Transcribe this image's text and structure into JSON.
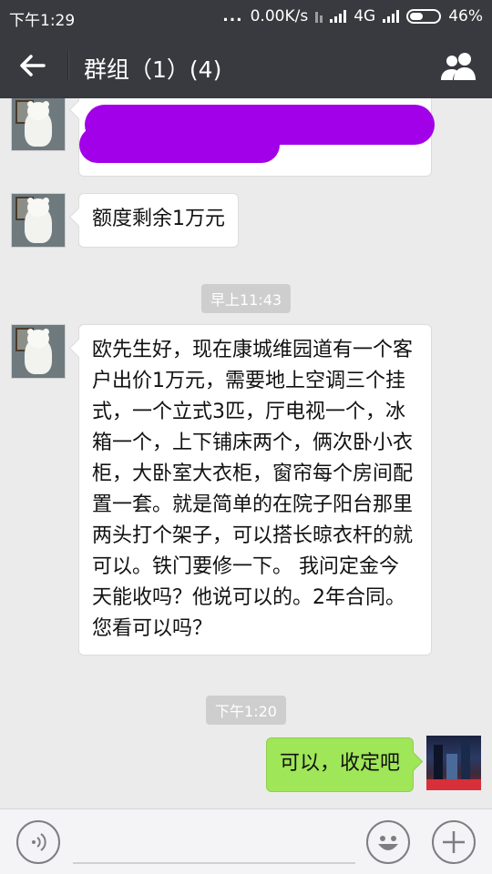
{
  "status_bar": {
    "time": "下午1:29",
    "dots": "...",
    "network_speed": "0.00K/s",
    "network_type": "4G",
    "battery": "46%"
  },
  "header": {
    "title": "群组（1）(4)"
  },
  "messages": [
    {
      "sender": "other",
      "text": "额度剩余1万元"
    },
    {
      "sender": "other",
      "text": "欧先生好，现在康城维园道有一个客户出价1万元，需要地上空调三个挂式，一个立式3匹，厅电视一个，冰箱一个，上下铺床两个，俩次卧小衣柜，大卧室大衣柜，窗帘每个房间配置一套。就是简单的在院子阳台那里两头打个架子，可以搭长晾衣杆的就可以。铁门要修一下。 我问定金今天能收吗？他说可以的。2年合同。您看可以吗？"
    },
    {
      "sender": "me",
      "text": "可以，收定吧"
    }
  ],
  "timestamps": [
    "早上11:43",
    "下午1:20"
  ],
  "colors": {
    "header_bg": "#393a3f",
    "chat_bg": "#ebebeb",
    "my_bubble": "#9fe658",
    "redaction": "#a100e8"
  },
  "icons": [
    "back-arrow-icon",
    "group-members-icon",
    "voice-icon",
    "emoji-icon",
    "plus-icon"
  ]
}
